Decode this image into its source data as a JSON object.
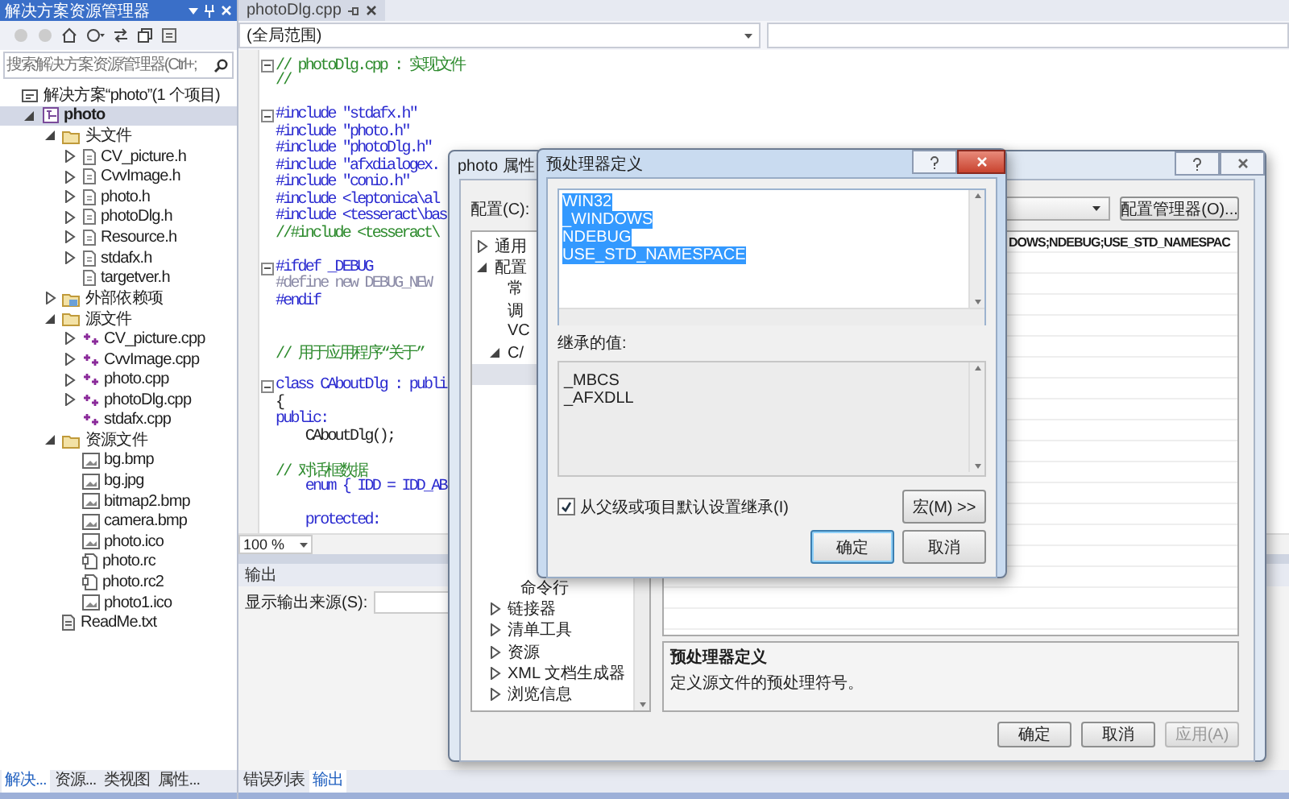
{
  "solution_explorer": {
    "title": "解决方案资源管理器",
    "search": {
      "placeholder": "搜索解决方案资源管理器(Ctrl+;"
    },
    "tree": [
      {
        "label": "解决方案“photo”(1 个项目)",
        "kind": "solution",
        "selected": false,
        "children": [
          {
            "label": "photo",
            "kind": "project",
            "expanded": true,
            "selected": true,
            "children": [
              {
                "label": "头文件",
                "kind": "folder",
                "expanded": true,
                "selected": false,
                "children": [
                  {
                    "label": "CV_picture.h",
                    "kind": "header",
                    "expanded": false,
                    "selected": false
                  },
                  {
                    "label": "CvvImage.h",
                    "kind": "header",
                    "expanded": false,
                    "selected": false
                  },
                  {
                    "label": "photo.h",
                    "kind": "header",
                    "expanded": false,
                    "selected": false
                  },
                  {
                    "label": "photoDlg.h",
                    "kind": "header",
                    "expanded": false,
                    "selected": false
                  },
                  {
                    "label": "Resource.h",
                    "kind": "header",
                    "expanded": false,
                    "selected": false
                  },
                  {
                    "label": "stdafx.h",
                    "kind": "header",
                    "expanded": false,
                    "selected": false
                  },
                  {
                    "label": "targetver.h",
                    "kind": "header",
                    "selected": false
                  }
                ]
              },
              {
                "label": "外部依赖项",
                "kind": "external",
                "expanded": false,
                "selected": false
              },
              {
                "label": "源文件",
                "kind": "folder",
                "expanded": true,
                "selected": false,
                "children": [
                  {
                    "label": "CV_picture.cpp",
                    "kind": "cpp",
                    "expanded": false,
                    "selected": false
                  },
                  {
                    "label": "CvvImage.cpp",
                    "kind": "cpp",
                    "expanded": false,
                    "selected": false
                  },
                  {
                    "label": "photo.cpp",
                    "kind": "cpp",
                    "expanded": false,
                    "selected": false
                  },
                  {
                    "label": "photoDlg.cpp",
                    "kind": "cpp",
                    "expanded": false,
                    "selected": false
                  },
                  {
                    "label": "stdafx.cpp",
                    "kind": "cpp",
                    "selected": false
                  }
                ]
              },
              {
                "label": "资源文件",
                "kind": "folder",
                "expanded": true,
                "selected": false,
                "children": [
                  {
                    "label": "bg.bmp",
                    "kind": "image",
                    "selected": false
                  },
                  {
                    "label": "bg.jpg",
                    "kind": "image",
                    "selected": false
                  },
                  {
                    "label": "bitmap2.bmp",
                    "kind": "image",
                    "selected": false
                  },
                  {
                    "label": "camera.bmp",
                    "kind": "image",
                    "selected": false
                  },
                  {
                    "label": "photo.ico",
                    "kind": "image",
                    "selected": false
                  },
                  {
                    "label": "photo.rc",
                    "kind": "resource",
                    "selected": false
                  },
                  {
                    "label": "photo.rc2",
                    "kind": "resource",
                    "selected": false
                  },
                  {
                    "label": "photo1.ico",
                    "kind": "image",
                    "selected": false
                  }
                ]
              },
              {
                "label": "ReadMe.txt",
                "kind": "text",
                "selected": false
              }
            ]
          }
        ]
      }
    ],
    "tabs": [
      {
        "label": "解决...",
        "selected": true
      },
      {
        "label": "资源...",
        "selected": false
      },
      {
        "label": "类视图",
        "selected": false
      },
      {
        "label": "属性...",
        "selected": false
      }
    ]
  },
  "editor": {
    "tab": "photoDlg.cpp",
    "scope": "(全局范围)",
    "zoom": "100 %",
    "lines": [
      {
        "text": "// photoDlg.cpp : 实现文件",
        "kind": "comment",
        "expanded": true
      },
      {
        "text": "//",
        "kind": "comment"
      },
      {
        "kind": "blank"
      },
      {
        "text": "#include \"stdafx.h\"",
        "kind": "directive",
        "expanded": true
      },
      {
        "text": "#include \"photo.h\"",
        "kind": "directive"
      },
      {
        "text": "#include \"photoDlg.h\"",
        "kind": "directive"
      },
      {
        "text": "#include \"afxdialogex.",
        "kind": "directive"
      },
      {
        "text": "#include \"conio.h\"",
        "kind": "directive"
      },
      {
        "text": "#include <leptonica\\al",
        "kind": "directive"
      },
      {
        "text": "#include <tesseract\\bas",
        "kind": "directive"
      },
      {
        "text": "//#include <tesseract\\",
        "kind": "comment"
      },
      {
        "kind": "blank"
      },
      {
        "text": "#ifdef _DEBUG",
        "kind": "directive",
        "expanded": true
      },
      {
        "text": "#define new DEBUG_NEW",
        "kind": "inactive"
      },
      {
        "text": "#endif",
        "kind": "directive"
      },
      {
        "kind": "blank"
      },
      {
        "kind": "blank"
      },
      {
        "text": "// 用于应用程序“关于”",
        "kind": "comment"
      },
      {
        "kind": "blank"
      },
      {
        "text": "class CAboutDlg : publi",
        "kind": "keyword",
        "expanded": true
      },
      {
        "text": "{",
        "kind": "plain"
      },
      {
        "text": "public:",
        "kind": "keyword"
      },
      {
        "text": "    CAboutDlg();",
        "kind": "plain"
      },
      {
        "kind": "blank"
      },
      {
        "text": "// 对话框数据",
        "kind": "comment"
      },
      {
        "text": "    enum { IDD = IDD_AB",
        "kind": "keyword"
      },
      {
        "kind": "blank"
      },
      {
        "text": "    protected:",
        "kind": "keyword"
      }
    ]
  },
  "output": {
    "title": "输出",
    "source_label": "显示输出来源(S):"
  },
  "bottom_tabs": [
    {
      "label": "错误列表",
      "selected": false
    },
    {
      "label": "输出",
      "selected": true
    }
  ],
  "property_dialog": {
    "title": "photo 属性",
    "config_label": "配置(C):",
    "manager_button": "配置管理器(O)...",
    "tree": [
      {
        "label": "通用",
        "expanded": false,
        "selected": false
      },
      {
        "label": "配置",
        "expanded": true,
        "selected": false,
        "children": [
          {
            "label": "常",
            "selected": false
          },
          {
            "label": "调",
            "selected": false
          },
          {
            "label": "VC",
            "selected": false
          },
          {
            "label": "C/",
            "expanded": true,
            "selected": false,
            "children": [
              {
                "selected": true
              },
              {
                "label": "命令行",
                "selected": false
              }
            ]
          },
          {
            "label": "链接器",
            "expanded": false,
            "selected": false
          },
          {
            "label": "清单工具",
            "expanded": false,
            "selected": false
          },
          {
            "label": "资源",
            "expanded": false,
            "selected": false
          },
          {
            "label": "XML 文档生成器",
            "expanded": false,
            "selected": false
          },
          {
            "label": "浏览信息",
            "expanded": false,
            "selected": false
          }
        ]
      }
    ],
    "grid_value": "DOWS;NDEBUG;USE_STD_NAMESPAC",
    "description": {
      "title": "预处理器定义",
      "text": "定义源文件的预处理符号。"
    },
    "buttons": [
      {
        "label": "确定",
        "disabled": false
      },
      {
        "label": "取消",
        "disabled": false
      },
      {
        "label": "应用(A)",
        "disabled": true
      }
    ]
  },
  "preprocessor_dialog": {
    "title": "预处理器定义",
    "definitions": [
      "WIN32",
      "_WINDOWS",
      "NDEBUG",
      "USE_STD_NAMESPACE"
    ],
    "definitions_selected": true,
    "inherited_label": "继承的值:",
    "inherited": [
      "_MBCS",
      "_AFXDLL"
    ],
    "inherit_checkbox": {
      "label": "从父级或项目默认设置继承(I)",
      "checked": true
    },
    "macro_button": "宏(M) >>",
    "buttons": [
      {
        "label": "确定",
        "default": true
      },
      {
        "label": "取消",
        "default": false
      }
    ]
  }
}
